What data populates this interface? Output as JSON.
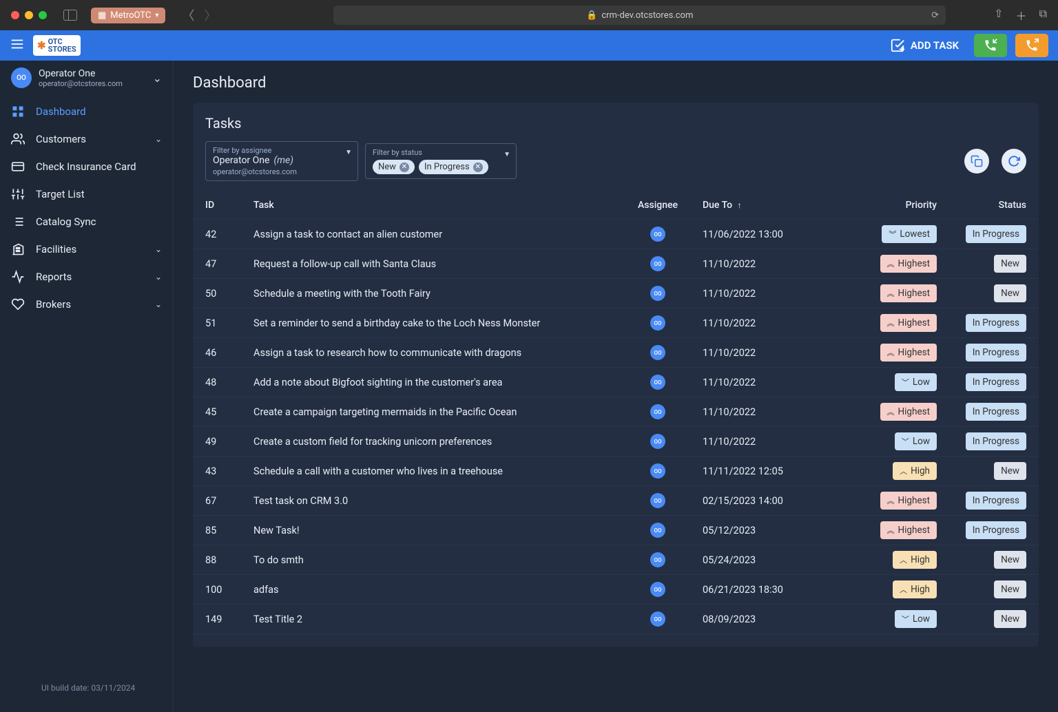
{
  "browser": {
    "tab_title": "MetroOTC",
    "url": "crm-dev.otcstores.com"
  },
  "logo": {
    "top": "OTC",
    "bottom": "STORES"
  },
  "header": {
    "add_task_label": "ADD TASK"
  },
  "user": {
    "initials": "OO",
    "name": "Operator One",
    "email": "operator@otcstores.com"
  },
  "sidebar": {
    "items": [
      {
        "label": "Dashboard",
        "active": true,
        "expand": false
      },
      {
        "label": "Customers",
        "active": false,
        "expand": true
      },
      {
        "label": "Check Insurance Card",
        "active": false,
        "expand": false
      },
      {
        "label": "Target List",
        "active": false,
        "expand": false
      },
      {
        "label": "Catalog Sync",
        "active": false,
        "expand": false
      },
      {
        "label": "Facilities",
        "active": false,
        "expand": true
      },
      {
        "label": "Reports",
        "active": false,
        "expand": true
      },
      {
        "label": "Brokers",
        "active": false,
        "expand": true
      }
    ],
    "build_date": "UI build date: 03/11/2024"
  },
  "page": {
    "title": "Dashboard"
  },
  "tasks": {
    "title": "Tasks",
    "filter_assignee_label": "Filter by assignee",
    "filter_assignee_value": "Operator One",
    "filter_assignee_me": "(me)",
    "filter_assignee_sub": "operator@otcstores.com",
    "filter_status_label": "Filter by status",
    "status_chips": [
      "New",
      "In Progress"
    ],
    "columns": {
      "id": "ID",
      "task": "Task",
      "assignee": "Assignee",
      "due": "Due To",
      "priority": "Priority",
      "status": "Status"
    },
    "rows": [
      {
        "id": "42",
        "task": "Assign a task to contact an alien customer",
        "assignee": "OO",
        "due": "11/06/2022 13:00",
        "priority": "Lowest",
        "status": "In Progress"
      },
      {
        "id": "47",
        "task": "Request a follow-up call with Santa Claus",
        "assignee": "OO",
        "due": "11/10/2022",
        "priority": "Highest",
        "status": "New"
      },
      {
        "id": "50",
        "task": "Schedule a meeting with the Tooth Fairy",
        "assignee": "OO",
        "due": "11/10/2022",
        "priority": "Highest",
        "status": "New"
      },
      {
        "id": "51",
        "task": "Set a reminder to send a birthday cake to the Loch Ness Monster",
        "assignee": "OO",
        "due": "11/10/2022",
        "priority": "Highest",
        "status": "In Progress"
      },
      {
        "id": "46",
        "task": "Assign a task to research how to communicate with dragons",
        "assignee": "OO",
        "due": "11/10/2022",
        "priority": "Highest",
        "status": "In Progress"
      },
      {
        "id": "48",
        "task": "Add a note about Bigfoot sighting in the customer's area",
        "assignee": "OO",
        "due": "11/10/2022",
        "priority": "Low",
        "status": "In Progress"
      },
      {
        "id": "45",
        "task": "Create a campaign targeting mermaids in the Pacific Ocean",
        "assignee": "OO",
        "due": "11/10/2022",
        "priority": "Highest",
        "status": "In Progress"
      },
      {
        "id": "49",
        "task": "Create a custom field for tracking unicorn preferences",
        "assignee": "OO",
        "due": "11/10/2022",
        "priority": "Low",
        "status": "In Progress"
      },
      {
        "id": "43",
        "task": "Schedule a call with a customer who lives in a treehouse",
        "assignee": "OO",
        "due": "11/11/2022 12:05",
        "priority": "High",
        "status": "New"
      },
      {
        "id": "67",
        "task": "Test task on CRM 3.0",
        "assignee": "OO",
        "due": "02/15/2023 14:00",
        "priority": "Highest",
        "status": "In Progress"
      },
      {
        "id": "85",
        "task": "New Task!",
        "assignee": "OO",
        "due": "05/12/2023",
        "priority": "Highest",
        "status": "In Progress"
      },
      {
        "id": "88",
        "task": "To do smth",
        "assignee": "OO",
        "due": "05/24/2023",
        "priority": "High",
        "status": "New"
      },
      {
        "id": "100",
        "task": "adfas",
        "assignee": "OO",
        "due": "06/21/2023 18:30",
        "priority": "High",
        "status": "New"
      },
      {
        "id": "149",
        "task": "Test Title 2",
        "assignee": "OO",
        "due": "08/09/2023",
        "priority": "Low",
        "status": "New"
      }
    ]
  }
}
